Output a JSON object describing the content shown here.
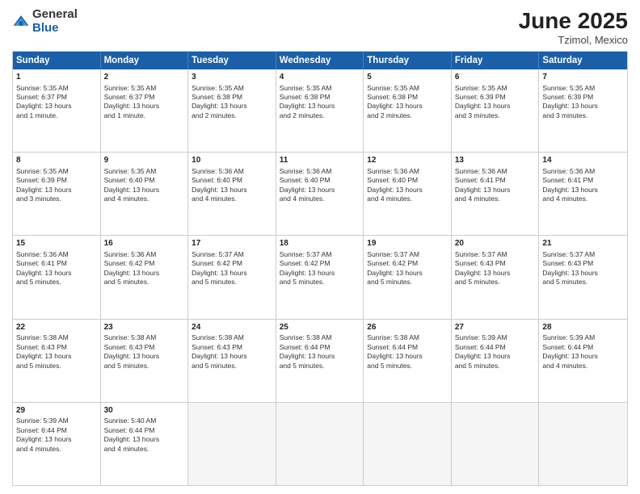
{
  "header": {
    "logo_general": "General",
    "logo_blue": "Blue",
    "month_year": "June 2025",
    "location": "Tzimol, Mexico"
  },
  "weekdays": [
    "Sunday",
    "Monday",
    "Tuesday",
    "Wednesday",
    "Thursday",
    "Friday",
    "Saturday"
  ],
  "rows": [
    [
      {
        "day": "1",
        "lines": [
          "Sunrise: 5:35 AM",
          "Sunset: 6:37 PM",
          "Daylight: 13 hours",
          "and 1 minute."
        ]
      },
      {
        "day": "2",
        "lines": [
          "Sunrise: 5:35 AM",
          "Sunset: 6:37 PM",
          "Daylight: 13 hours",
          "and 1 minute."
        ]
      },
      {
        "day": "3",
        "lines": [
          "Sunrise: 5:35 AM",
          "Sunset: 6:38 PM",
          "Daylight: 13 hours",
          "and 2 minutes."
        ]
      },
      {
        "day": "4",
        "lines": [
          "Sunrise: 5:35 AM",
          "Sunset: 6:38 PM",
          "Daylight: 13 hours",
          "and 2 minutes."
        ]
      },
      {
        "day": "5",
        "lines": [
          "Sunrise: 5:35 AM",
          "Sunset: 6:38 PM",
          "Daylight: 13 hours",
          "and 2 minutes."
        ]
      },
      {
        "day": "6",
        "lines": [
          "Sunrise: 5:35 AM",
          "Sunset: 6:39 PM",
          "Daylight: 13 hours",
          "and 3 minutes."
        ]
      },
      {
        "day": "7",
        "lines": [
          "Sunrise: 5:35 AM",
          "Sunset: 6:39 PM",
          "Daylight: 13 hours",
          "and 3 minutes."
        ]
      }
    ],
    [
      {
        "day": "8",
        "lines": [
          "Sunrise: 5:35 AM",
          "Sunset: 6:39 PM",
          "Daylight: 13 hours",
          "and 3 minutes."
        ]
      },
      {
        "day": "9",
        "lines": [
          "Sunrise: 5:35 AM",
          "Sunset: 6:40 PM",
          "Daylight: 13 hours",
          "and 4 minutes."
        ]
      },
      {
        "day": "10",
        "lines": [
          "Sunrise: 5:36 AM",
          "Sunset: 6:40 PM",
          "Daylight: 13 hours",
          "and 4 minutes."
        ]
      },
      {
        "day": "11",
        "lines": [
          "Sunrise: 5:36 AM",
          "Sunset: 6:40 PM",
          "Daylight: 13 hours",
          "and 4 minutes."
        ]
      },
      {
        "day": "12",
        "lines": [
          "Sunrise: 5:36 AM",
          "Sunset: 6:40 PM",
          "Daylight: 13 hours",
          "and 4 minutes."
        ]
      },
      {
        "day": "13",
        "lines": [
          "Sunrise: 5:36 AM",
          "Sunset: 6:41 PM",
          "Daylight: 13 hours",
          "and 4 minutes."
        ]
      },
      {
        "day": "14",
        "lines": [
          "Sunrise: 5:36 AM",
          "Sunset: 6:41 PM",
          "Daylight: 13 hours",
          "and 4 minutes."
        ]
      }
    ],
    [
      {
        "day": "15",
        "lines": [
          "Sunrise: 5:36 AM",
          "Sunset: 6:41 PM",
          "Daylight: 13 hours",
          "and 5 minutes."
        ]
      },
      {
        "day": "16",
        "lines": [
          "Sunrise: 5:36 AM",
          "Sunset: 6:42 PM",
          "Daylight: 13 hours",
          "and 5 minutes."
        ]
      },
      {
        "day": "17",
        "lines": [
          "Sunrise: 5:37 AM",
          "Sunset: 6:42 PM",
          "Daylight: 13 hours",
          "and 5 minutes."
        ]
      },
      {
        "day": "18",
        "lines": [
          "Sunrise: 5:37 AM",
          "Sunset: 6:42 PM",
          "Daylight: 13 hours",
          "and 5 minutes."
        ]
      },
      {
        "day": "19",
        "lines": [
          "Sunrise: 5:37 AM",
          "Sunset: 6:42 PM",
          "Daylight: 13 hours",
          "and 5 minutes."
        ]
      },
      {
        "day": "20",
        "lines": [
          "Sunrise: 5:37 AM",
          "Sunset: 6:43 PM",
          "Daylight: 13 hours",
          "and 5 minutes."
        ]
      },
      {
        "day": "21",
        "lines": [
          "Sunrise: 5:37 AM",
          "Sunset: 6:43 PM",
          "Daylight: 13 hours",
          "and 5 minutes."
        ]
      }
    ],
    [
      {
        "day": "22",
        "lines": [
          "Sunrise: 5:38 AM",
          "Sunset: 6:43 PM",
          "Daylight: 13 hours",
          "and 5 minutes."
        ]
      },
      {
        "day": "23",
        "lines": [
          "Sunrise: 5:38 AM",
          "Sunset: 6:43 PM",
          "Daylight: 13 hours",
          "and 5 minutes."
        ]
      },
      {
        "day": "24",
        "lines": [
          "Sunrise: 5:38 AM",
          "Sunset: 6:43 PM",
          "Daylight: 13 hours",
          "and 5 minutes."
        ]
      },
      {
        "day": "25",
        "lines": [
          "Sunrise: 5:38 AM",
          "Sunset: 6:44 PM",
          "Daylight: 13 hours",
          "and 5 minutes."
        ]
      },
      {
        "day": "26",
        "lines": [
          "Sunrise: 5:38 AM",
          "Sunset: 6:44 PM",
          "Daylight: 13 hours",
          "and 5 minutes."
        ]
      },
      {
        "day": "27",
        "lines": [
          "Sunrise: 5:39 AM",
          "Sunset: 6:44 PM",
          "Daylight: 13 hours",
          "and 5 minutes."
        ]
      },
      {
        "day": "28",
        "lines": [
          "Sunrise: 5:39 AM",
          "Sunset: 6:44 PM",
          "Daylight: 13 hours",
          "and 4 minutes."
        ]
      }
    ],
    [
      {
        "day": "29",
        "lines": [
          "Sunrise: 5:39 AM",
          "Sunset: 6:44 PM",
          "Daylight: 13 hours",
          "and 4 minutes."
        ]
      },
      {
        "day": "30",
        "lines": [
          "Sunrise: 5:40 AM",
          "Sunset: 6:44 PM",
          "Daylight: 13 hours",
          "and 4 minutes."
        ]
      },
      {
        "day": "",
        "lines": []
      },
      {
        "day": "",
        "lines": []
      },
      {
        "day": "",
        "lines": []
      },
      {
        "day": "",
        "lines": []
      },
      {
        "day": "",
        "lines": []
      }
    ]
  ]
}
